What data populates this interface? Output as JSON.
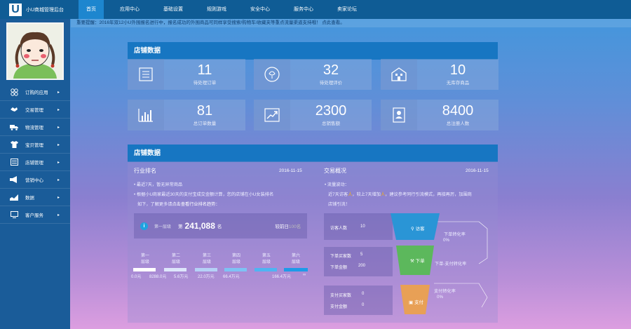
{
  "app": {
    "logo": "U",
    "title": "小U商城管理后台"
  },
  "nav": [
    "首页",
    "应用中心",
    "基础设置",
    "规则游戏",
    "安全中心",
    "服务中心",
    "卖家论坛"
  ],
  "notice": "重要提醒：2016年双12小U外围报名进行中，报名成功的外围商品可同样享受搜索/购物车/收藏夹等重点流量渠道支持哦！ 点此查看。",
  "sidebar": [
    {
      "label": "订购的应用",
      "icon": "apps-icon"
    },
    {
      "label": "交易管理",
      "icon": "handshake-icon"
    },
    {
      "label": "物流管理",
      "icon": "truck-icon"
    },
    {
      "label": "宝贝管理",
      "icon": "shirt-icon"
    },
    {
      "label": "店铺管理",
      "icon": "store-icon"
    },
    {
      "label": "营销中心",
      "icon": "megaphone-icon"
    },
    {
      "label": "数据",
      "icon": "chart-icon"
    },
    {
      "label": "客户服务",
      "icon": "service-icon"
    }
  ],
  "panel1": {
    "title": "店铺数据",
    "stats": [
      {
        "value": "11",
        "label": "待处理订单",
        "icon": "list-icon"
      },
      {
        "value": "32",
        "label": "待处理评价",
        "icon": "rose-icon"
      },
      {
        "value": "10",
        "label": "无库存商品",
        "icon": "building-icon"
      },
      {
        "value": "81",
        "label": "总订单数量",
        "icon": "bar-chart-icon"
      },
      {
        "value": "2300",
        "label": "总销售额",
        "icon": "trend-icon"
      },
      {
        "value": "8400",
        "label": "总注册人数",
        "icon": "id-card-icon"
      }
    ]
  },
  "panel2": {
    "title": "店铺数据",
    "industry": {
      "title": "行业排名",
      "date": "2016-11-15",
      "line1": "• 最近7天，暂无异常商品",
      "line2": "• 根据小U商家最近30天的支付宝成交金额计算，您的店铺在小U女装排名",
      "line3": "如下，了解更多请",
      "line3_link": "点击查看行业排名趋势：",
      "rank_tier": "第一层级",
      "rank_prefix": "第",
      "rank_value": "241,088",
      "rank_suffix": "名",
      "compare_label": "较前日",
      "compare_value": "100名",
      "tiers": [
        {
          "name": "第一",
          "sub": "层级",
          "color": "#ffffff"
        },
        {
          "name": "第二",
          "sub": "层级",
          "color": "#dde6fb"
        },
        {
          "name": "第三",
          "sub": "层级",
          "color": "#b5d1f6"
        },
        {
          "name": "第四",
          "sub": "层级",
          "color": "#7ec2f4"
        },
        {
          "name": "第五",
          "sub": "层级",
          "color": "#4fb4f2"
        },
        {
          "name": "第六",
          "sub": "层级",
          "color": "#1e9ae8"
        }
      ],
      "tier_values": [
        "0.0元",
        "8288.0元",
        "5.6万元",
        "22.0万元",
        "66.4万元",
        "166.4万元",
        "∞"
      ]
    },
    "trade": {
      "title": "交易概况",
      "date": "2016-11-15",
      "line1": "• 流量波动：",
      "line2a": "近7天访客",
      "line2b": "人",
      "line2c": "，较上7天增加",
      "line2d": "人",
      "line2e": "，建议参考同行引流模式，再接再厉，加围商",
      "line3": "店铺引流！",
      "rows": [
        {
          "labels": [
            "访客人数"
          ],
          "values": [
            "10"
          ]
        },
        {
          "labels": [
            "下单买家数",
            "下单金额"
          ],
          "values": [
            "5",
            "200"
          ]
        },
        {
          "labels": [
            "支付买家数",
            "支付金额"
          ],
          "values": [
            "0",
            "0"
          ]
        }
      ],
      "funnel": [
        {
          "label": "访客",
          "color": "#2a95d6",
          "icon": "visitor-icon"
        },
        {
          "label": "下单",
          "color": "#5cb85c",
          "icon": "hammer-icon"
        },
        {
          "label": "支付",
          "color": "#e8a056",
          "icon": "pay-icon"
        }
      ],
      "rates": [
        {
          "label": "下单转化率",
          "value": "0%"
        },
        {
          "label": "下单-支付转化率",
          "value": ""
        },
        {
          "label": "支付转化率",
          "value": "0%"
        }
      ]
    }
  }
}
